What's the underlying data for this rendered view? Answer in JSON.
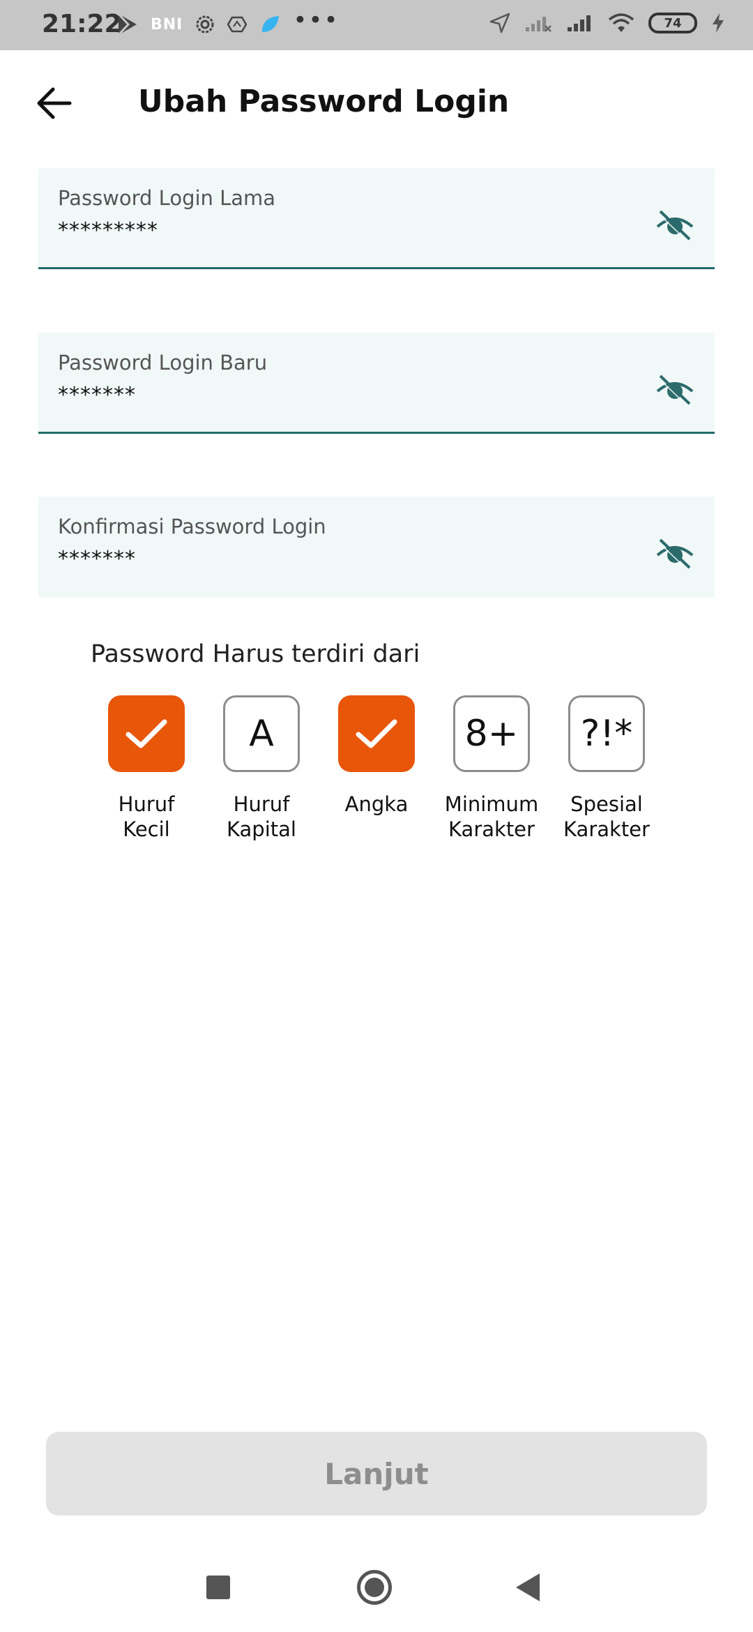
{
  "status_bar": {
    "time": "21:22",
    "bni_label": "BNI",
    "battery_level": "74",
    "icons": [
      "play-store-icon",
      "bni-icon",
      "gear-icon",
      "app-icon",
      "bluebird-icon",
      "more-dots-icon",
      "location-icon",
      "signal-off-icon",
      "signal-icon",
      "wifi-icon",
      "battery-icon",
      "charging-icon"
    ]
  },
  "header": {
    "title": "Ubah Password Login"
  },
  "fields": [
    {
      "label": "Password Login Lama",
      "value": "*********"
    },
    {
      "label": "Password Login Baru",
      "value": "*******"
    },
    {
      "label": "Konfirmasi Password Login",
      "value": "*******"
    }
  ],
  "rules": {
    "title": "Password Harus terdiri dari",
    "items": [
      {
        "symbol": "",
        "label_line1": "Huruf",
        "label_line2": "Kecil",
        "checked": true
      },
      {
        "symbol": "A",
        "label_line1": "Huruf",
        "label_line2": "Kapital",
        "checked": false
      },
      {
        "symbol": "",
        "label_line1": "Angka",
        "label_line2": "",
        "checked": true
      },
      {
        "symbol": "8+",
        "label_line1": "Minimum",
        "label_line2": "Karakter",
        "checked": false
      },
      {
        "symbol": "?!*",
        "label_line1": "Spesial",
        "label_line2": "Karakter",
        "checked": false
      }
    ],
    "check_color": "#e8560a"
  },
  "actions": {
    "next_label": "Lanjut"
  },
  "colors": {
    "field_bg": "#f1f9f8",
    "underline": "#1f6b6b",
    "eye_icon": "#2c6b6b",
    "button_bg": "#e3e3e3",
    "button_text": "#8e8e8e"
  }
}
